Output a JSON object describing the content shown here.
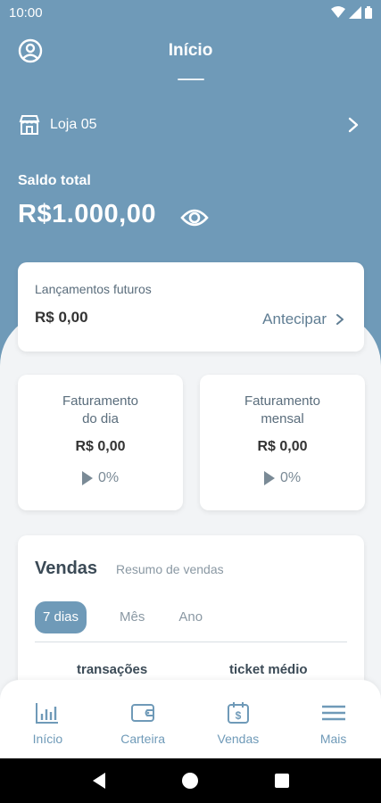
{
  "status_bar": {
    "time": "10:00"
  },
  "header": {
    "title": "Início"
  },
  "store": {
    "name": "Loja 05"
  },
  "balance": {
    "label": "Saldo total",
    "value": "R$1.000,00"
  },
  "future": {
    "title": "Lançamentos futuros",
    "value": "R$ 0,00",
    "action": "Antecipar"
  },
  "daily": {
    "title_line1": "Faturamento",
    "title_line2": "do dia",
    "value": "R$ 0,00",
    "trend": "0%"
  },
  "monthly": {
    "title_line1": "Faturamento",
    "title_line2": "mensal",
    "value": "R$ 0,00",
    "trend": "0%"
  },
  "sales": {
    "title": "Vendas",
    "subtitle": "Resumo de vendas",
    "tabs": [
      "7 dias",
      "Mês",
      "Ano"
    ],
    "active_tab": "7 dias",
    "columns": [
      "transações",
      "ticket médio"
    ]
  },
  "bottom_nav": {
    "items": [
      {
        "label": "Início",
        "icon": "bar-chart-icon"
      },
      {
        "label": "Carteira",
        "icon": "wallet-icon"
      },
      {
        "label": "Vendas",
        "icon": "calendar-dollar-icon"
      },
      {
        "label": "Mais",
        "icon": "menu-icon"
      }
    ]
  },
  "colors": {
    "primary": "#6f9ab8",
    "background": "#f2f4f6",
    "card": "#ffffff",
    "text_dark": "#333333"
  }
}
